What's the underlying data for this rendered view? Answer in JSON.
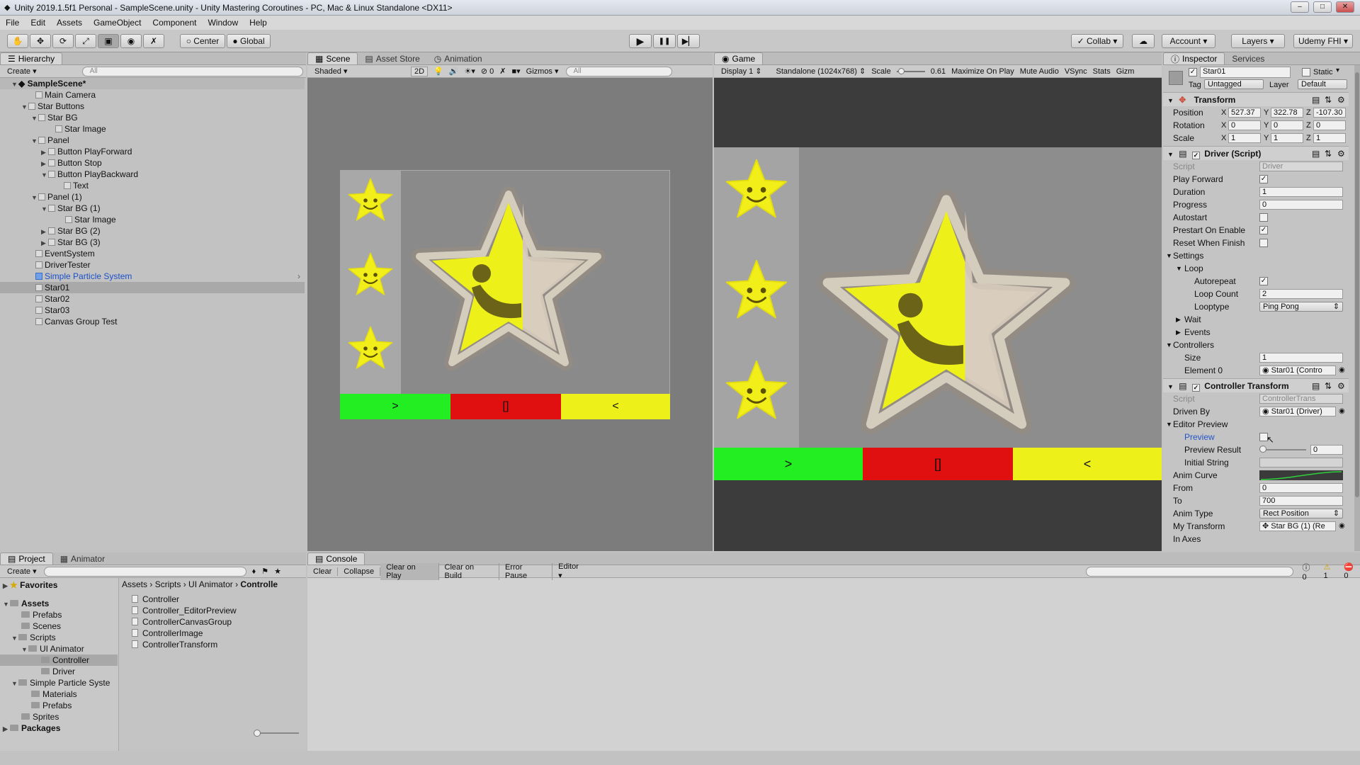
{
  "window": {
    "title": "Unity 2019.1.5f1 Personal - SampleScene.unity - Unity Mastering Coroutines - PC, Mac & Linux Standalone <DX11>",
    "minimize": "–",
    "maximize": "□",
    "close": "✕"
  },
  "menu": [
    "File",
    "Edit",
    "Assets",
    "GameObject",
    "Component",
    "Window",
    "Help"
  ],
  "toolbar": {
    "center_label": "Center",
    "global_label": "Global",
    "play_icon": "▶",
    "pause_icon": "❚❚",
    "step_icon": "▶▏",
    "collab_label": "Collab",
    "account_label": "Account",
    "layers_label": "Layers",
    "layout_label": "Udemy FHI"
  },
  "hierarchy": {
    "tab": "Hierarchy",
    "create": "Create",
    "search_placeholder": "All",
    "scene_name": "SampleScene*",
    "items": [
      {
        "label": "Main Camera",
        "arrow": ""
      },
      {
        "label": "Star Buttons",
        "arrow": "▼"
      },
      {
        "label": "Star BG",
        "arrow": "▼"
      },
      {
        "label": "Star Image",
        "arrow": ""
      },
      {
        "label": "Panel",
        "arrow": "▼"
      },
      {
        "label": "Button PlayForward",
        "arrow": "▶"
      },
      {
        "label": "Button Stop",
        "arrow": "▶"
      },
      {
        "label": "Button PlayBackward",
        "arrow": "▼"
      },
      {
        "label": "Text",
        "arrow": ""
      },
      {
        "label": "Panel (1)",
        "arrow": "▼"
      },
      {
        "label": "Star BG (1)",
        "arrow": "▼"
      },
      {
        "label": "Star Image",
        "arrow": ""
      },
      {
        "label": "Star BG (2)",
        "arrow": "▶"
      },
      {
        "label": "Star BG (3)",
        "arrow": "▶"
      },
      {
        "label": "EventSystem",
        "arrow": ""
      },
      {
        "label": "DriverTester",
        "arrow": ""
      },
      {
        "label": "Simple Particle System",
        "arrow": ""
      },
      {
        "label": "Star01",
        "arrow": ""
      },
      {
        "label": "Star02",
        "arrow": ""
      },
      {
        "label": "Star03",
        "arrow": ""
      },
      {
        "label": "Canvas Group Test",
        "arrow": ""
      }
    ]
  },
  "scene": {
    "tabs": [
      "Scene",
      "Asset Store",
      "Animation"
    ],
    "shading": "Shaded",
    "mode_2d": "2D",
    "gizmos": "Gizmos",
    "search_placeholder": "All",
    "hidden_count": "0",
    "btn_forward": ">",
    "btn_stop": "[]",
    "btn_backward": "<"
  },
  "game": {
    "tab": "Game",
    "display": "Display 1",
    "resolution": "Standalone (1024x768)",
    "scale_label": "Scale",
    "scale_value": "0.61",
    "maximize": "Maximize On Play",
    "mute": "Mute Audio",
    "vsync": "VSync",
    "stats": "Stats",
    "gizmos": "Gizm",
    "btn_forward": ">",
    "btn_stop": "[]",
    "btn_backward": "<"
  },
  "inspector": {
    "tabs": [
      "Inspector",
      "Services"
    ],
    "object_name": "Star01",
    "static_label": "Static",
    "tag_label": "Tag",
    "tag_value": "Untagged",
    "layer_label": "Layer",
    "layer_value": "Default",
    "transform": {
      "title": "Transform",
      "position_label": "Position",
      "position": {
        "x": "527.37",
        "y": "322.78",
        "z": "-107.30"
      },
      "rotation_label": "Rotation",
      "rotation": {
        "x": "0",
        "y": "0",
        "z": "0"
      },
      "scale_label": "Scale",
      "scale": {
        "x": "1",
        "y": "1",
        "z": "1"
      }
    },
    "driver": {
      "title": "Driver (Script)",
      "script_label": "Script",
      "script_value": "Driver",
      "play_forward": "Play Forward",
      "duration": "Duration",
      "duration_value": "1",
      "progress": "Progress",
      "progress_value": "0",
      "autostart": "Autostart",
      "prestart": "Prestart On Enable",
      "reset": "Reset When Finish",
      "settings": "Settings",
      "loop": "Loop",
      "autorepeat": "Autorepeat",
      "loop_count": "Loop Count",
      "loop_count_value": "2",
      "looptype": "Looptype",
      "looptype_value": "Ping Pong",
      "wait": "Wait",
      "events": "Events",
      "controllers": "Controllers",
      "size": "Size",
      "size_value": "1",
      "element0": "Element 0",
      "element0_value": "Star01 (Contro"
    },
    "ctrl": {
      "title": "Controller Transform",
      "script_label": "Script",
      "script_value": "ControllerTrans",
      "driven_by": "Driven By",
      "driven_by_value": "Star01 (Driver)",
      "editor_preview": "Editor Preview",
      "preview": "Preview",
      "preview_result": "Preview Result",
      "preview_result_value": "0",
      "initial_string": "Initial String",
      "anim_curve": "Anim Curve",
      "from": "From",
      "from_value": "0",
      "to": "To",
      "to_value": "700",
      "anim_type": "Anim Type",
      "anim_type_value": "Rect Position",
      "my_transform": "My Transform",
      "my_transform_value": "Star BG (1) (Re",
      "in_axes": "In Axes"
    }
  },
  "project": {
    "tabs": [
      "Project",
      "Animator"
    ],
    "create": "Create",
    "favorites": "Favorites",
    "tree": [
      {
        "label": "Assets",
        "bold": true,
        "indent": 0
      },
      {
        "label": "Prefabs",
        "indent": 1
      },
      {
        "label": "Scenes",
        "indent": 1
      },
      {
        "label": "Scripts",
        "indent": 1
      },
      {
        "label": "UI Animator",
        "indent": 2
      },
      {
        "label": "Controller",
        "indent": 3
      },
      {
        "label": "Driver",
        "indent": 3
      },
      {
        "label": "Simple Particle Syste",
        "indent": 1
      },
      {
        "label": "Materials",
        "indent": 2
      },
      {
        "label": "Prefabs",
        "indent": 2
      },
      {
        "label": "Sprites",
        "indent": 1
      },
      {
        "label": "Packages",
        "bold": true,
        "indent": 0
      }
    ],
    "breadcrumb": [
      "Assets",
      "Scripts",
      "UI Animator",
      "Controlle"
    ],
    "files": [
      "Controller",
      "Controller_EditorPreview",
      "ControllerCanvasGroup",
      "ControllerImage",
      "ControllerTransform"
    ]
  },
  "console": {
    "tab": "Console",
    "buttons": [
      "Clear",
      "Collapse",
      "Clear on Play",
      "Clear on Build",
      "Error Pause",
      "Editor"
    ],
    "info_count": "0",
    "warn_count": "1",
    "error_count": "0"
  },
  "colors": {
    "btn_green": "#22ee22",
    "btn_red": "#e01010",
    "btn_yellow": "#eef01a",
    "star_yellow": "#f2ee1a"
  }
}
